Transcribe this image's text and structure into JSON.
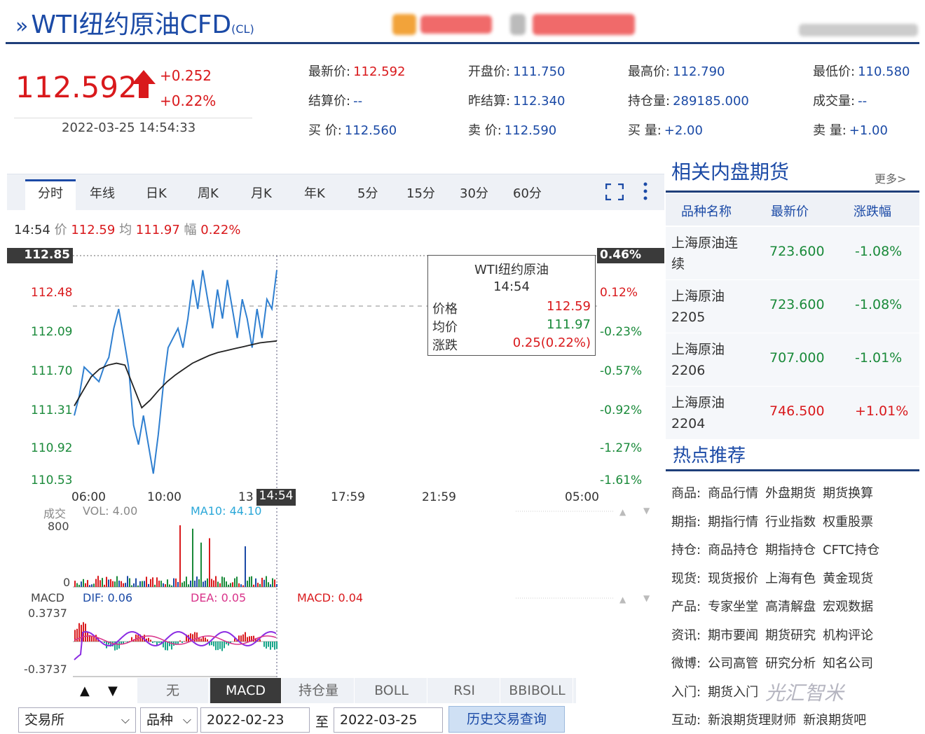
{
  "header": {
    "title": "WTI纽约原油CFD",
    "code": "(CL)"
  },
  "quote": {
    "price": "112.592",
    "change": "+0.252",
    "change_pct": "+0.22%",
    "time": "2022-03-25 14:54:33",
    "fields": [
      {
        "label": "最新价:",
        "value": "112.592",
        "red": true
      },
      {
        "label": "开盘价:",
        "value": "111.750"
      },
      {
        "label": "最高价:",
        "value": "112.790"
      },
      {
        "label": "最低价:",
        "value": "110.580"
      },
      {
        "label": "结算价:",
        "value": "--"
      },
      {
        "label": "昨结算:",
        "value": "112.340"
      },
      {
        "label": "持仓量:",
        "value": "289185.000"
      },
      {
        "label": "成交量:",
        "value": "--"
      },
      {
        "label": "买  价:",
        "value": "112.560"
      },
      {
        "label": "卖  价:",
        "value": "112.590"
      },
      {
        "label": "买  量:",
        "value": "+2.00"
      },
      {
        "label": "卖  量:",
        "value": "+1.00"
      }
    ]
  },
  "tabs": [
    "分时",
    "年线",
    "日K",
    "周K",
    "月K",
    "年K",
    "5分",
    "15分",
    "30分",
    "60分"
  ],
  "info_line": {
    "time": "14:54",
    "price_label": "价",
    "price": "112.59",
    "avg_label": "均",
    "avg": "111.97",
    "amp_label": "幅",
    "amp": "0.22%"
  },
  "chart_data": {
    "type": "line",
    "y_left_ticks": [
      "112.85",
      "112.48",
      "112.09",
      "111.70",
      "111.31",
      "110.92",
      "110.53"
    ],
    "y_right_ticks": [
      "0.46%",
      "0.12%",
      "-0.23%",
      "-0.57%",
      "-0.92%",
      "-1.27%",
      "-1.61%"
    ],
    "x_ticks": [
      "06:00",
      "10:00",
      "13",
      "17:59",
      "21:59",
      "05:00"
    ],
    "cursor_time": "14:54",
    "ylim": [
      110.53,
      112.85
    ],
    "series": [
      {
        "name": "价格",
        "values": [
          111.2,
          111.4,
          111.7,
          111.65,
          111.6,
          111.55,
          111.7,
          111.8,
          112.1,
          112.3,
          112.0,
          111.7,
          111.1,
          110.9,
          111.2,
          110.9,
          110.6,
          111.0,
          111.5,
          111.9,
          112.0,
          112.1,
          111.9,
          112.2,
          112.6,
          112.3,
          112.7,
          112.4,
          112.1,
          112.5,
          112.2,
          112.6,
          112.3,
          112.0,
          112.4,
          112.2,
          111.9,
          112.3,
          112.0,
          112.4,
          112.3,
          112.7
        ]
      },
      {
        "name": "均价",
        "values": [
          111.3,
          111.45,
          111.6,
          111.68,
          111.72,
          111.74,
          111.72,
          111.5,
          111.28,
          111.36,
          111.46,
          111.55,
          111.62,
          111.68,
          111.74,
          111.78,
          111.82,
          111.85,
          111.87,
          111.89,
          111.91,
          111.93,
          111.95,
          111.96,
          111.97
        ]
      }
    ],
    "volume": {
      "label": "成交",
      "vol_label": "VOL: 4.00",
      "ma_label": "MA10: 44.10",
      "max_tick": "800",
      "min_tick": "0"
    },
    "macd": {
      "label": "MACD",
      "dif": "DIF: 0.06",
      "dea": "DEA: 0.05",
      "macd": "MACD: 0.04",
      "max_tick": "0.3737",
      "min_tick": "-0.3737"
    }
  },
  "tooltip": {
    "title": "WTI纽约原油",
    "time": "14:54",
    "rows": [
      {
        "label": "价格",
        "value": "112.59"
      },
      {
        "label": "均价",
        "value": "111.97"
      },
      {
        "label": "涨跌",
        "value": "0.25(0.22%)"
      }
    ]
  },
  "indicator_tabs": [
    "无",
    "MACD",
    "持仓量",
    "BOLL",
    "RSI",
    "BBIBOLL"
  ],
  "controls": {
    "exchange": "交易所",
    "variety": "品种",
    "start_date": "2022-02-23",
    "to_label": "至",
    "end_date": "2022-03-25",
    "history_button": "历史交易查询"
  },
  "related": {
    "title": "相关内盘期货",
    "more": "更多>",
    "headers": [
      "品种名称",
      "最新价",
      "涨跌幅"
    ],
    "rows": [
      {
        "name": "上海原油连续",
        "price": "723.600",
        "pct": "-1.08%",
        "up": false
      },
      {
        "name": "上海原油2205",
        "price": "723.600",
        "pct": "-1.08%",
        "up": false
      },
      {
        "name": "上海原油2206",
        "price": "707.000",
        "pct": "-1.01%",
        "up": false
      },
      {
        "name": "上海原油2204",
        "price": "746.500",
        "pct": "+1.01%",
        "up": true
      }
    ]
  },
  "hot": {
    "title": "热点推荐",
    "rows": [
      {
        "label": "商品:",
        "links": [
          "商品行情",
          "外盘期货",
          "期货换算"
        ]
      },
      {
        "label": "期指:",
        "links": [
          "期指行情",
          "行业指数",
          "权重股票"
        ]
      },
      {
        "label": "持仓:",
        "links": [
          "商品持仓",
          "期指持仓",
          "CFTC持仓"
        ]
      },
      {
        "label": "现货:",
        "links": [
          "现货报价",
          "上海有色",
          "黄金现货"
        ]
      },
      {
        "label": "产品:",
        "links": [
          "专家坐堂",
          "高清解盘",
          "宏观数据"
        ]
      },
      {
        "label": "资讯:",
        "links": [
          "期市要闻",
          "期货研究",
          "机构评论"
        ]
      },
      {
        "label": "微博:",
        "links": [
          "公司高管",
          "研究分析",
          "知名公司"
        ]
      },
      {
        "label": "入门:",
        "links": [
          "期货入门",
          "",
          ""
        ]
      },
      {
        "label": "互动:",
        "links": [
          "新浪期货理财师",
          "新浪期货吧"
        ]
      }
    ]
  },
  "colors": {
    "accent": "#1b4aa6",
    "up": "#d9191c",
    "down": "#1a8a3a",
    "dark": "#3a3a3a"
  }
}
